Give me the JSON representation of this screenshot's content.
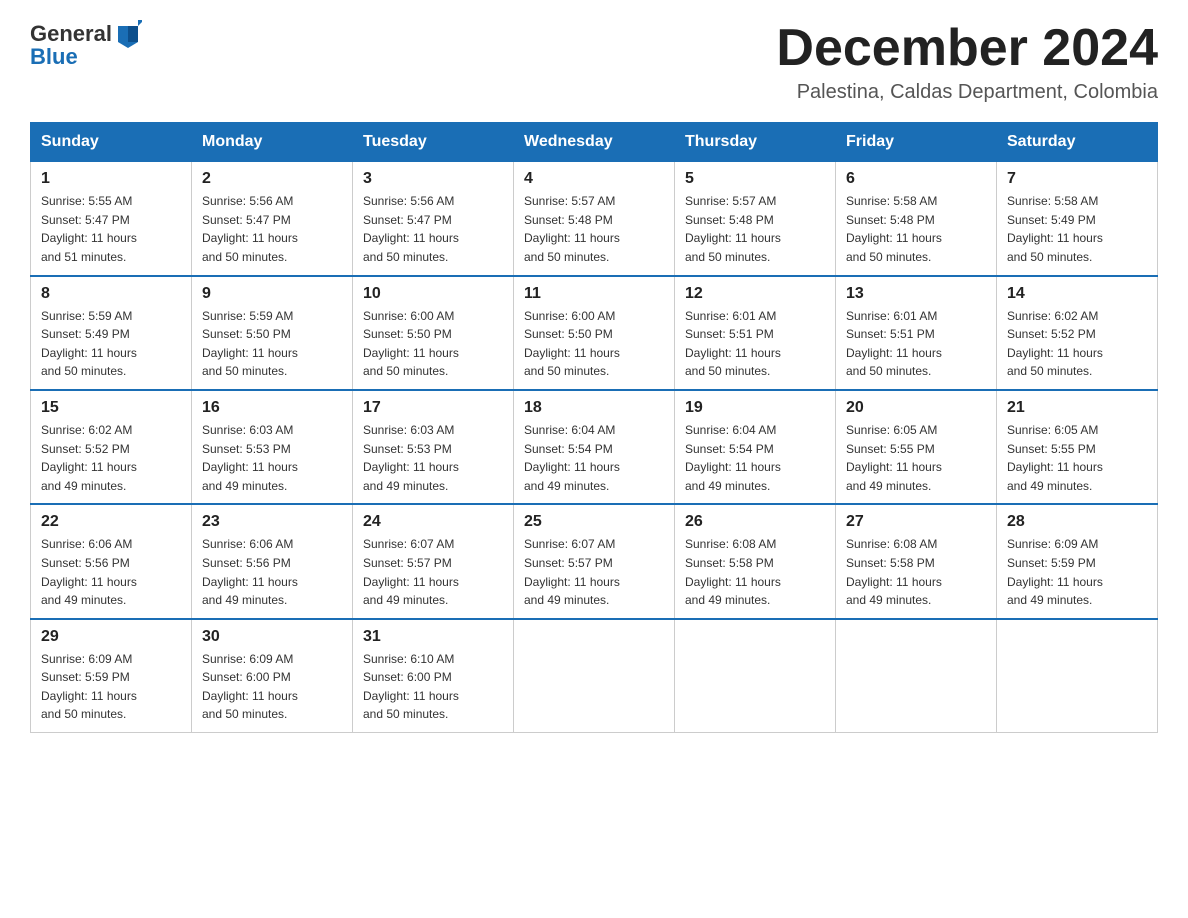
{
  "header": {
    "logo_general": "General",
    "logo_blue": "Blue",
    "month_title": "December 2024",
    "location": "Palestina, Caldas Department, Colombia"
  },
  "days_of_week": [
    "Sunday",
    "Monday",
    "Tuesday",
    "Wednesday",
    "Thursday",
    "Friday",
    "Saturday"
  ],
  "weeks": [
    [
      {
        "day": "1",
        "sunrise": "5:55 AM",
        "sunset": "5:47 PM",
        "daylight": "11 hours and 51 minutes."
      },
      {
        "day": "2",
        "sunrise": "5:56 AM",
        "sunset": "5:47 PM",
        "daylight": "11 hours and 50 minutes."
      },
      {
        "day": "3",
        "sunrise": "5:56 AM",
        "sunset": "5:47 PM",
        "daylight": "11 hours and 50 minutes."
      },
      {
        "day": "4",
        "sunrise": "5:57 AM",
        "sunset": "5:48 PM",
        "daylight": "11 hours and 50 minutes."
      },
      {
        "day": "5",
        "sunrise": "5:57 AM",
        "sunset": "5:48 PM",
        "daylight": "11 hours and 50 minutes."
      },
      {
        "day": "6",
        "sunrise": "5:58 AM",
        "sunset": "5:48 PM",
        "daylight": "11 hours and 50 minutes."
      },
      {
        "day": "7",
        "sunrise": "5:58 AM",
        "sunset": "5:49 PM",
        "daylight": "11 hours and 50 minutes."
      }
    ],
    [
      {
        "day": "8",
        "sunrise": "5:59 AM",
        "sunset": "5:49 PM",
        "daylight": "11 hours and 50 minutes."
      },
      {
        "day": "9",
        "sunrise": "5:59 AM",
        "sunset": "5:50 PM",
        "daylight": "11 hours and 50 minutes."
      },
      {
        "day": "10",
        "sunrise": "6:00 AM",
        "sunset": "5:50 PM",
        "daylight": "11 hours and 50 minutes."
      },
      {
        "day": "11",
        "sunrise": "6:00 AM",
        "sunset": "5:50 PM",
        "daylight": "11 hours and 50 minutes."
      },
      {
        "day": "12",
        "sunrise": "6:01 AM",
        "sunset": "5:51 PM",
        "daylight": "11 hours and 50 minutes."
      },
      {
        "day": "13",
        "sunrise": "6:01 AM",
        "sunset": "5:51 PM",
        "daylight": "11 hours and 50 minutes."
      },
      {
        "day": "14",
        "sunrise": "6:02 AM",
        "sunset": "5:52 PM",
        "daylight": "11 hours and 50 minutes."
      }
    ],
    [
      {
        "day": "15",
        "sunrise": "6:02 AM",
        "sunset": "5:52 PM",
        "daylight": "11 hours and 49 minutes."
      },
      {
        "day": "16",
        "sunrise": "6:03 AM",
        "sunset": "5:53 PM",
        "daylight": "11 hours and 49 minutes."
      },
      {
        "day": "17",
        "sunrise": "6:03 AM",
        "sunset": "5:53 PM",
        "daylight": "11 hours and 49 minutes."
      },
      {
        "day": "18",
        "sunrise": "6:04 AM",
        "sunset": "5:54 PM",
        "daylight": "11 hours and 49 minutes."
      },
      {
        "day": "19",
        "sunrise": "6:04 AM",
        "sunset": "5:54 PM",
        "daylight": "11 hours and 49 minutes."
      },
      {
        "day": "20",
        "sunrise": "6:05 AM",
        "sunset": "5:55 PM",
        "daylight": "11 hours and 49 minutes."
      },
      {
        "day": "21",
        "sunrise": "6:05 AM",
        "sunset": "5:55 PM",
        "daylight": "11 hours and 49 minutes."
      }
    ],
    [
      {
        "day": "22",
        "sunrise": "6:06 AM",
        "sunset": "5:56 PM",
        "daylight": "11 hours and 49 minutes."
      },
      {
        "day": "23",
        "sunrise": "6:06 AM",
        "sunset": "5:56 PM",
        "daylight": "11 hours and 49 minutes."
      },
      {
        "day": "24",
        "sunrise": "6:07 AM",
        "sunset": "5:57 PM",
        "daylight": "11 hours and 49 minutes."
      },
      {
        "day": "25",
        "sunrise": "6:07 AM",
        "sunset": "5:57 PM",
        "daylight": "11 hours and 49 minutes."
      },
      {
        "day": "26",
        "sunrise": "6:08 AM",
        "sunset": "5:58 PM",
        "daylight": "11 hours and 49 minutes."
      },
      {
        "day": "27",
        "sunrise": "6:08 AM",
        "sunset": "5:58 PM",
        "daylight": "11 hours and 49 minutes."
      },
      {
        "day": "28",
        "sunrise": "6:09 AM",
        "sunset": "5:59 PM",
        "daylight": "11 hours and 49 minutes."
      }
    ],
    [
      {
        "day": "29",
        "sunrise": "6:09 AM",
        "sunset": "5:59 PM",
        "daylight": "11 hours and 50 minutes."
      },
      {
        "day": "30",
        "sunrise": "6:09 AM",
        "sunset": "6:00 PM",
        "daylight": "11 hours and 50 minutes."
      },
      {
        "day": "31",
        "sunrise": "6:10 AM",
        "sunset": "6:00 PM",
        "daylight": "11 hours and 50 minutes."
      },
      null,
      null,
      null,
      null
    ]
  ],
  "labels": {
    "sunrise": "Sunrise:",
    "sunset": "Sunset:",
    "daylight": "Daylight:"
  }
}
